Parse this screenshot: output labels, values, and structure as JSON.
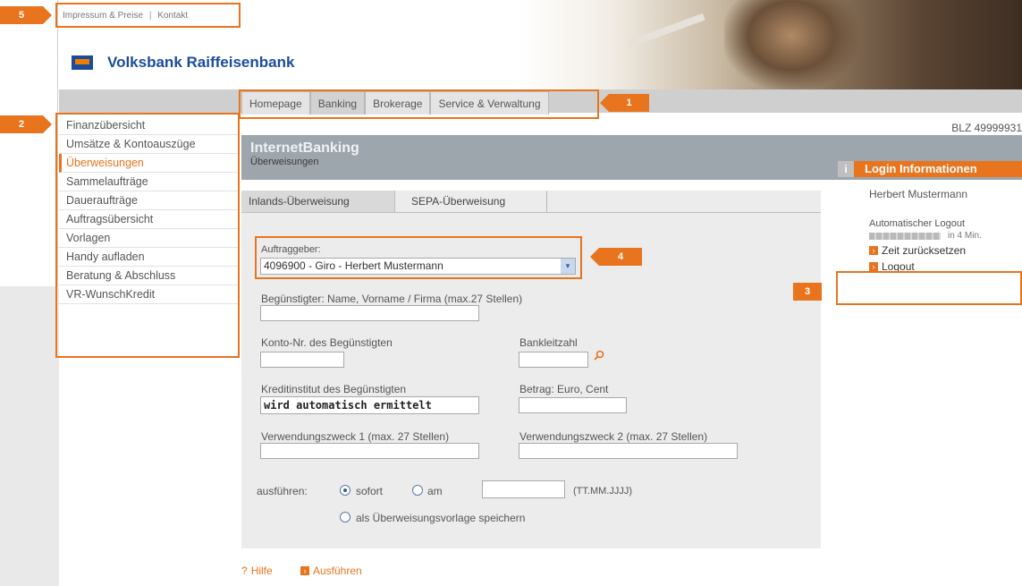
{
  "top_links": {
    "impressum": "Impressum & Preise",
    "separator": "|",
    "kontakt": "Kontakt"
  },
  "bank": {
    "name": "Volksbank Raiffeisenbank",
    "logo": "vr-bank-logo-icon"
  },
  "nav_tabs": [
    "Homepage",
    "Banking",
    "Brokerage",
    "Service & Verwaltung"
  ],
  "active_nav_tab": "Banking",
  "sidebar": {
    "items": [
      "Finanzübersicht",
      "Umsätze & Kontoauszüge",
      "Überweisungen",
      "Sammelaufträge",
      "Daueraufträge",
      "Auftragsübersicht",
      "Vorlagen",
      "Handy aufladen",
      "Beratung & Abschluss",
      "VR-WunschKredit"
    ],
    "active": "Überweisungen"
  },
  "blz": "BLZ 49999931",
  "header": {
    "title": "InternetBanking",
    "subtitle": "Überweisungen"
  },
  "form_tabs": [
    "Inlands-Überweisung",
    "SEPA-Überweisung"
  ],
  "form": {
    "auftraggeber_label": "Auftraggeber:",
    "auftraggeber_value": "4096900 - Giro - Herbert Mustermann",
    "beguenstigter_label": "Begünstigter: Name, Vorname / Firma (max.27 Stellen)",
    "konto_label": "Konto-Nr. des Begünstigten",
    "blz_label": "Bankleitzahl",
    "kreditinstitut_label": "Kreditinstitut des Begünstigten",
    "kreditinstitut_value": "wird automatisch ermittelt",
    "betrag_label": "Betrag: Euro, Cent",
    "vz1_label": "Verwendungszweck 1 (max. 27 Stellen)",
    "vz2_label": "Verwendungszweck 2 (max. 27 Stellen)",
    "ausfuehren_label": "ausführen:",
    "sofort_label": "sofort",
    "am_label": "am",
    "date_hint": "(TT.MM.JJJJ)",
    "vorlage_label": "als Überweisungsvorlage speichern"
  },
  "login_info": {
    "heading": "Login Informationen",
    "info_glyph": "i",
    "user": "Herbert Mustermann",
    "auto_logout": "Automatischer Logout",
    "remaining": "in 4 Min.",
    "reset": "Zeit zurücksetzen",
    "logout": "Logout"
  },
  "actions": {
    "help": "Hilfe",
    "help_glyph": "?",
    "execute": "Ausführen"
  },
  "arrow_glyph": "›",
  "dropdown_glyph": "▾",
  "annotations": [
    "1",
    "2",
    "3",
    "4",
    "5"
  ],
  "colors": {
    "accent": "#e8741e",
    "brand": "#1b4d9c",
    "band": "#9da6ac"
  }
}
